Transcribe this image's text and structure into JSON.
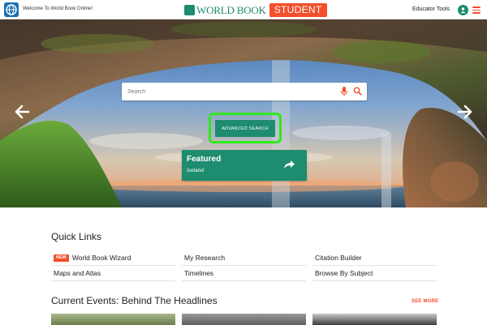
{
  "header": {
    "welcome_text": "Welcome To World Book Online!",
    "brand_name": "WORLD BOOK",
    "brand_badge": "STUDENT",
    "educator_tools": "Educator Tools",
    "colors": {
      "brand_green": "#1e8c6e",
      "accent_orange": "#f24f2b"
    }
  },
  "hero": {
    "search_placeholder": "Search",
    "advanced_search_label": "ADVANCED SEARCH",
    "highlight_color": "#2fe81c",
    "featured": {
      "title": "Featured",
      "subtitle": "Iceland"
    }
  },
  "quick_links": {
    "title": "Quick Links",
    "items": [
      {
        "label": "World Book Wizard",
        "badge": "NEW"
      },
      {
        "label": "My Research"
      },
      {
        "label": "Citation Builder"
      },
      {
        "label": "Maps and Atlas"
      },
      {
        "label": "Timelines"
      },
      {
        "label": "Browse By Subject"
      }
    ]
  },
  "current_events": {
    "title": "Current Events: Behind The Headlines",
    "see_more": "SEE MORE"
  }
}
